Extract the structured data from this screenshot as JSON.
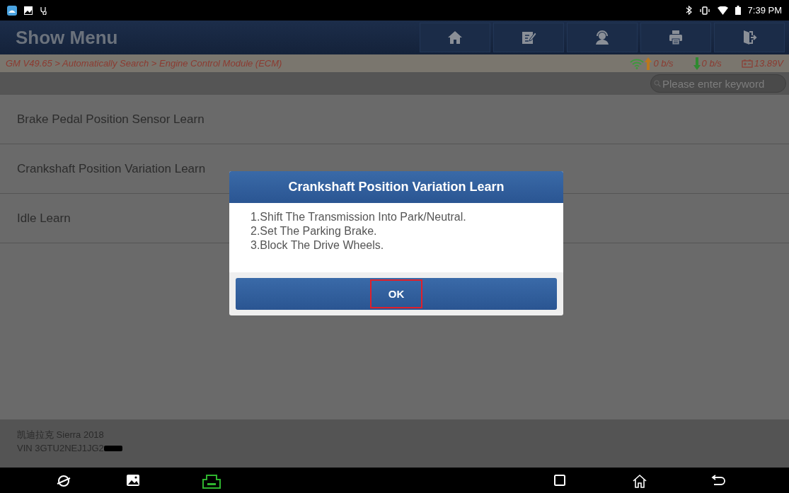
{
  "status_bar": {
    "time": "7:39 PM"
  },
  "title_bar": {
    "title": "Show Menu",
    "toolbar": [
      {
        "kind": "home"
      },
      {
        "kind": "edit"
      },
      {
        "kind": "support"
      },
      {
        "kind": "print"
      },
      {
        "kind": "exit"
      }
    ]
  },
  "info_bar": {
    "breadcrumb": "GM V49.65 > Automatically Search > Engine Control Module (ECM)",
    "upload": "0 b/s",
    "download": "0 b/s",
    "voltage": "13.89V"
  },
  "search": {
    "placeholder": "Please enter keyword"
  },
  "menu_items": [
    {
      "label": "Brake Pedal Position Sensor Learn"
    },
    {
      "label": "Crankshaft Position Variation Learn"
    },
    {
      "label": "Idle Learn"
    }
  ],
  "footer": {
    "vehicle": "凯迪拉克 Sierra 2018",
    "vin": "VIN 3GTU2NEJ1JG2"
  },
  "dialog": {
    "title": "Crankshaft Position Variation Learn",
    "lines": [
      "1.Shift The Transmission Into Park/Neutral.",
      "2.Set The Parking Brake.",
      "3.Block The Drive Wheels."
    ],
    "button": {
      "label": "OK",
      "highlighted": true
    }
  }
}
